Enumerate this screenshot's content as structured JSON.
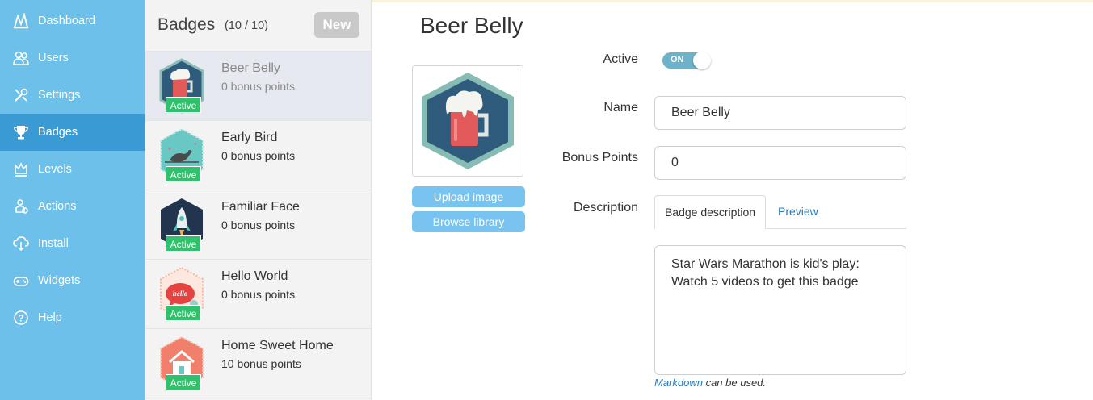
{
  "nav": {
    "items": [
      {
        "label": "Dashboard",
        "icon": "dashboard-icon"
      },
      {
        "label": "Users",
        "icon": "users-icon"
      },
      {
        "label": "Settings",
        "icon": "settings-icon"
      },
      {
        "label": "Badges",
        "icon": "trophy-icon"
      },
      {
        "label": "Levels",
        "icon": "crown-icon"
      },
      {
        "label": "Actions",
        "icon": "actions-icon"
      },
      {
        "label": "Install",
        "icon": "cloud-download-icon"
      },
      {
        "label": "Widgets",
        "icon": "gamepad-icon"
      },
      {
        "label": "Help",
        "icon": "help-icon"
      }
    ],
    "active": "Badges"
  },
  "badge_list": {
    "title": "Badges",
    "count": "(10 / 10)",
    "new_label": "New",
    "items": [
      {
        "name": "Beer Belly",
        "points": "0 bonus points",
        "status": "Active",
        "icon": "beer-mug-icon"
      },
      {
        "name": "Early Bird",
        "points": "0 bonus points",
        "status": "Active",
        "icon": "bird-icon"
      },
      {
        "name": "Familiar Face",
        "points": "0 bonus points",
        "status": "Active",
        "icon": "rocket-icon"
      },
      {
        "name": "Hello World",
        "points": "0 bonus points",
        "status": "Active",
        "icon": "hello-bubble-icon"
      },
      {
        "name": "Home Sweet Home",
        "points": "10 bonus points",
        "status": "Active",
        "icon": "house-icon"
      }
    ]
  },
  "editor": {
    "title": "Beer Belly",
    "upload_label": "Upload image",
    "browse_label": "Browse library",
    "active_label": "Active",
    "toggle_text": "ON",
    "name_label": "Name",
    "name_value": "Beer Belly",
    "bonus_label": "Bonus Points",
    "bonus_value": "0",
    "description_label": "Description",
    "tab_description": "Badge description",
    "tab_preview": "Preview",
    "description_value": "Star Wars Marathon is kid's play: Watch 5 videos to get this badge",
    "markdown_link": "Markdown",
    "markdown_suffix": " can be used."
  },
  "colors": {
    "nav_bg": "#6cc0ea",
    "nav_active": "#3a9bd4",
    "active_tag": "#2fc16b",
    "button_blue": "#78c3ef",
    "link_blue": "#2a7ab8"
  }
}
